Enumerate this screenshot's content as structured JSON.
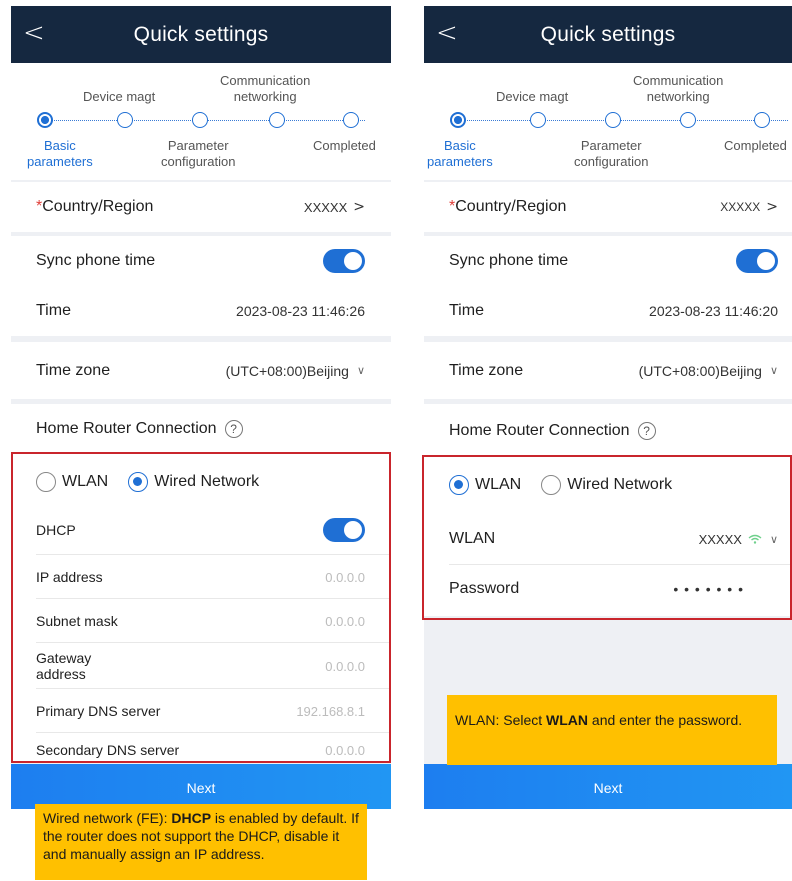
{
  "header": {
    "title": "Quick settings",
    "back_icon": "chevron-left-icon"
  },
  "steps": {
    "basic": "Basic\nparameters",
    "device": "Device magt",
    "param": "Parameter\nconfiguration",
    "comm": "Communication\nnetworking",
    "completed": "Completed"
  },
  "common": {
    "country_label": "Country/Region",
    "country_value": "XXXXX",
    "sync_label": "Sync phone time",
    "time_label": "Time",
    "timezone_label": "Time zone",
    "timezone_value": "(UTC+08:00)Beijing",
    "router_label": "Home Router Connection",
    "radio_wlan": "WLAN",
    "radio_wired": "Wired Network",
    "next_label": "Next"
  },
  "left": {
    "time_value": "2023-08-23 11:46:26",
    "selected": "Wired Network",
    "dhcp_label": "DHCP",
    "dhcp_enabled": true,
    "fields": [
      {
        "label": "IP address",
        "value": "0.0.0.0"
      },
      {
        "label": "Subnet mask",
        "value": "0.0.0.0"
      },
      {
        "label": "Gateway\naddress",
        "value": "0.0.0.0"
      },
      {
        "label": "Primary DNS server",
        "value": "192.168.8.1"
      },
      {
        "label": "Secondary DNS server",
        "value": "0.0.0.0"
      }
    ],
    "note": {
      "prefix": "Wired network (FE): ",
      "bold": "DHCP",
      "suffix": " is enabled by default. If the router does not support the DHCP, disable it and manually assign an IP address."
    }
  },
  "right": {
    "time_value": "2023-08-23 11:46:20",
    "selected": "WLAN",
    "wlan_label": "WLAN",
    "wlan_value": "XXXXX",
    "password_label": "Password",
    "password_value": "• • • • • • •",
    "note": {
      "prefix": "WLAN: Select ",
      "bold": "WLAN",
      "suffix": " and enter the password."
    }
  },
  "colors": {
    "header": "#152840",
    "accent": "#1f6fd4",
    "highlight_border": "#c9252c",
    "note_bg": "#ffc000"
  }
}
